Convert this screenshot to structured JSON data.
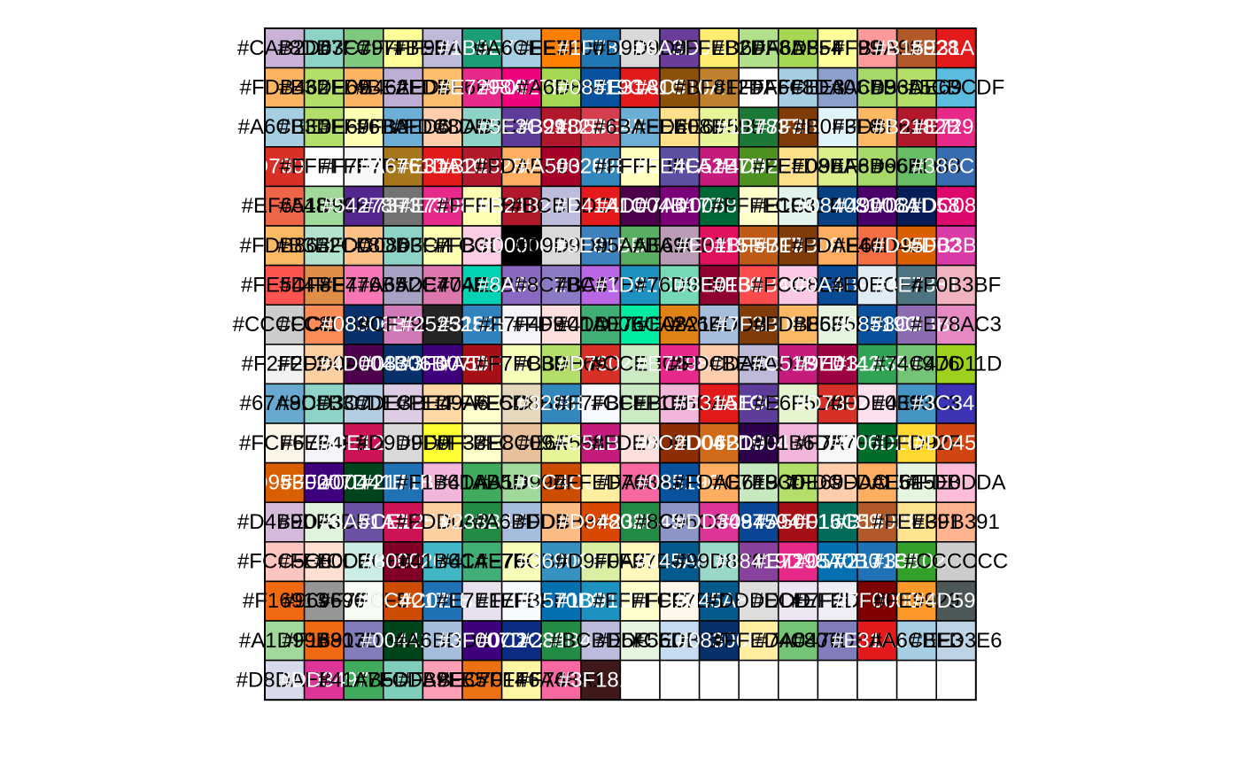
{
  "chart_data": {
    "type": "heatmap",
    "title": "",
    "ncol": 18,
    "nrow": 17,
    "label_colors": {
      "light": "#000000",
      "dark": "#ffffff"
    },
    "cells": [
      [
        "#CAB2D6",
        "#8DD3C7",
        "#7FC97F",
        "#FFFF99",
        "#BEBADA",
        "#1B9E77",
        "#A6CEE3",
        "#FF7F00",
        "#1F78B4",
        "#D9D9D9",
        "#6A3D9A",
        "#FFED6F",
        "#B2DF8A",
        "#A6D854",
        "#FFFF99",
        "#FB9A99",
        "#B15928",
        "#E31A1C"
      ],
      [
        "#FDB462",
        "#B3DE69",
        "#FDB462",
        "#BEAED4",
        "#FDBF6F",
        "#E7298A",
        "#F0027F",
        "#A6D854",
        "#08519C",
        "#E31A1C",
        "#8C510A",
        "#BF812D",
        "#FFFFFF",
        "#A6CEE3",
        "#8DA0CB",
        "#A6D96A",
        "#B3DE69",
        "#5CBCDF"
      ],
      [
        "#A6CEE3",
        "#B3DE69",
        "#FFFFB3",
        "#6BAED6",
        "#FDCDAC",
        "#8DD3C7",
        "#5E3C99",
        "#B2182B",
        "#D53E4F",
        "#6BAED6",
        "#FEE08B",
        "#E6F598",
        "#1B7837",
        "#7F3B08",
        "#E0F3F8",
        "#FDB863",
        "#B2182B",
        "#E7298A"
      ],
      [
        "#D73027",
        "#FFFFFF",
        "#F7F7F7",
        "#A6761D",
        "#E31A1C",
        "#B2182B",
        "#FDAE61",
        "#A50026",
        "#3288BD",
        "#FFFFBF",
        "#5E4FA2",
        "#C51B7D",
        "#4D9221",
        "#FEE08B",
        "#D9EF8B",
        "#A6D96A",
        "#66BD63",
        "#386CB0"
      ],
      [
        "#EF6548",
        "#A1D99B",
        "#54278F",
        "#737373",
        "#E7298A",
        "#FFFFB3",
        "#B2182B",
        "#BCBDDC",
        "#E41A1C",
        "#4D004B",
        "#7A0177",
        "#006837",
        "#FFFFCC",
        "#E1F3EB",
        "#084081",
        "#49006A",
        "#081D58",
        "#DC086B"
      ],
      [
        "#FDB863",
        "#B3E2CD",
        "#FDC086",
        "#8DD3C7",
        "#FFFFB3",
        "#FCCDE5",
        "#000000",
        "#D9D9D9",
        "#3E81BD",
        "#5AAE61",
        "#BA9CB7",
        "#E0115F",
        "#BF5B17",
        "#7F3B08",
        "#FDAE61",
        "#F46D43",
        "#D95F02",
        "#DB3BA6"
      ],
      [
        "#FE544F",
        "#DF8E47",
        "#F776B5",
        "#A6A2C4",
        "#DE77AE",
        "#04D2B5",
        "#8A69C2",
        "#8C7BC4",
        "#BA67E6",
        "#1D91C0",
        "#76D9B5",
        "#8E0130",
        "#FB4B4C",
        "#FCC8E6",
        "#0A4B96",
        "#E0ECF4",
        "#4E7381",
        "#F0B3BF"
      ],
      [
        "#CCCCCC",
        "#FC8D59",
        "#08306B",
        "#CF79B6",
        "#252525",
        "#3182BD",
        "#F7F4F9",
        "#FDE0DD",
        "#41AE76",
        "#00ECA2",
        "#E08214",
        "#A6BDDB",
        "#7F3B08",
        "#FDB863",
        "#E5F5E0",
        "#08519C",
        "#8C6BB1",
        "#E78AC3"
      ],
      [
        "#F2F2F2",
        "#FDD0A2",
        "#4D004B",
        "#08306B",
        "#3F007D",
        "#A50F15",
        "#F7FCB9",
        "#B3DE69",
        "#D73027",
        "#CCEBC5",
        "#E7298A",
        "#FDCDAC",
        "#BEBADA",
        "#C51B7D",
        "#9E0142",
        "#31A354",
        "#74C476",
        "#9DD11D"
      ],
      [
        "#67A9CF",
        "#8DD3C7",
        "#B3CDE3",
        "#DECBE4",
        "#FED9A6",
        "#FFFFCC",
        "#E5D8BD",
        "#3288BD",
        "#F7FBFF",
        "#CCEBC5",
        "#F1B6DA",
        "#E31A1C",
        "#5E3C99",
        "#E6F5D0",
        "#D73027",
        "#FDE0EF",
        "#4393C3",
        "#3C34B3"
      ],
      [
        "#FCF6E8",
        "#F7F4F9",
        "#CE1256",
        "#D9D9D9",
        "#FFFF33",
        "#FFFFCC",
        "#E8C09A",
        "#E6F598",
        "#C51B7D",
        "#FDE0DD",
        "#8C2D04",
        "#D06B19",
        "#2D004B",
        "#F1B6DA",
        "#F7F7F7",
        "#006D2C",
        "#FFD92F",
        "#D04511"
      ],
      [
        "#D95F02",
        "#3F007D",
        "#00441B",
        "#2171B5",
        "#F1B6DA",
        "#41AB5D",
        "#A1D99B",
        "#CC4C02",
        "#FFEDA0",
        "#F768A1",
        "#08519C",
        "#FDAE61",
        "#C7E9C0",
        "#B3DE69",
        "#FDCDAC",
        "#FDAE61",
        "#E5F5E0",
        "#FDBDDA"
      ],
      [
        "#D4B9DA",
        "#E0F3DB",
        "#6A51A3",
        "#CE1256",
        "#FDD0A2",
        "#238B45",
        "#A6BDDB",
        "#FDBB84",
        "#D94801",
        "#238B45",
        "#8C96C6",
        "#DD3497",
        "#084594",
        "#A50F15",
        "#016C59",
        "#B15928",
        "#FEE391",
        "#FFB391"
      ],
      [
        "#FCC5C0",
        "#FEE0D2",
        "#CCECE6",
        "#800026",
        "#41B6C4",
        "#41AE76",
        "#F7FCB9",
        "#3690C0",
        "#D9F0A3",
        "#FFF7BC",
        "#045A8D",
        "#99D8C9",
        "#88419D",
        "#E7298A",
        "#0570B0",
        "#2171B5",
        "#33A02C",
        "#CCCCCC"
      ],
      [
        "#F16913",
        "#969696",
        "#F7FCF5",
        "#CC4C02",
        "#2171B5",
        "#E7E1EF",
        "#F7FBFF",
        "#0570B0",
        "#1D91C0",
        "#FFFFCC",
        "#FFF7EC",
        "#045A8D",
        "#DDDDDD",
        "#ECE7F2",
        "#EFEDF5",
        "#7F0000",
        "#FE9929",
        "#4D5959"
      ],
      [
        "#A1D99B",
        "#F16913",
        "#807DBA",
        "#00441B",
        "#A6BDDB",
        "#3F007D",
        "#0C2C84",
        "#238B45",
        "#BCBDDC",
        "#E5F5E0",
        "#C6DBEF",
        "#08306B",
        "#FFEDA0",
        "#74C476",
        "#807DBA",
        "#E31A1C",
        "#A6CEE3",
        "#BFD3E6"
      ],
      [
        "#D8DAEB",
        "#DD3497",
        "#41AB5D",
        "#7FCDBB",
        "#FA9FB5",
        "#EC7014",
        "#FFF6A4",
        "#F768A1",
        "#3F1819",
        null,
        null,
        null,
        null,
        null,
        null,
        null,
        null,
        null
      ]
    ]
  }
}
